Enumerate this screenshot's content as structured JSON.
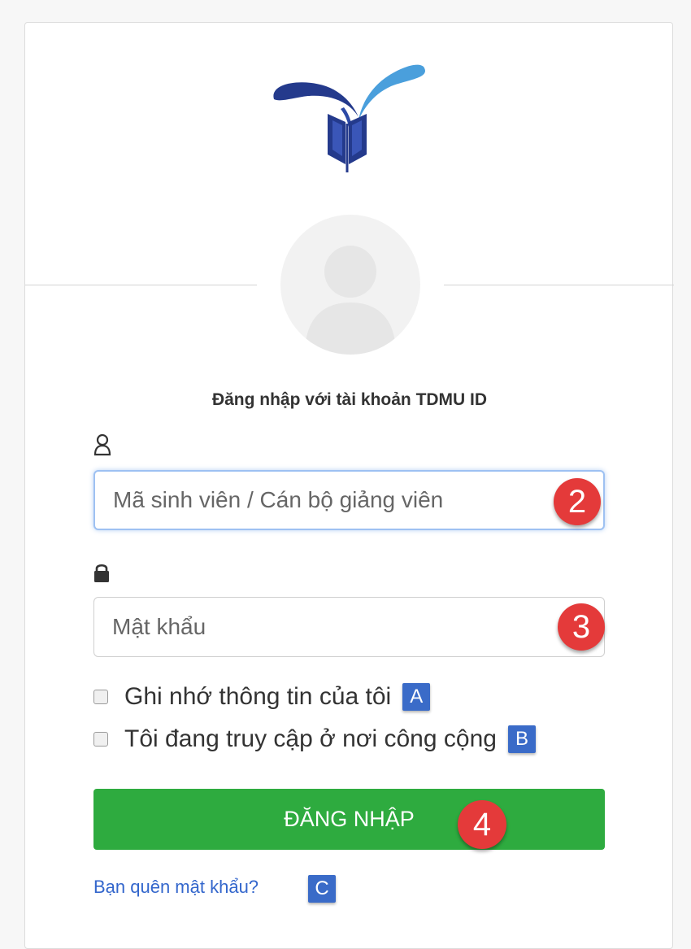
{
  "login": {
    "title": "Đăng nhập với tài khoản TDMU ID",
    "username_placeholder": "Mã sinh viên / Cán bộ giảng viên",
    "password_placeholder": "Mật khẩu",
    "remember_label": "Ghi nhớ thông tin của tôi",
    "public_label": "Tôi đang truy cập ở nơi công cộng",
    "submit_label": "ĐĂNG NHẬP",
    "forgot_label": "Bạn quên mật khẩu?"
  },
  "annotations": {
    "username": "2",
    "password": "3",
    "submit": "4",
    "remember": "A",
    "public": "B",
    "forgot": "C"
  },
  "icons": {
    "logo": "tdmu-logo",
    "avatar": "user-avatar-placeholder",
    "username": "user-icon",
    "password": "lock-icon"
  },
  "colors": {
    "submit_button": "#2eab3f",
    "number_badge": "#e43a3a",
    "letter_badge": "#3a6bc8",
    "link": "#3366cc",
    "focus_border": "#9ec1f2"
  },
  "state": {
    "username_focused": true,
    "remember_checked": false,
    "public_checked": false
  }
}
